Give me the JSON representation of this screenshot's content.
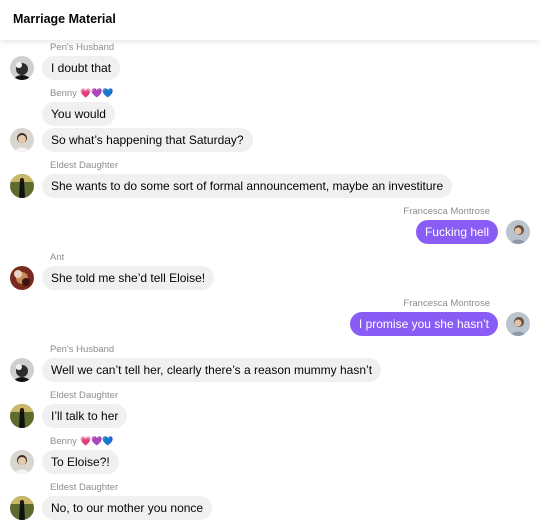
{
  "header": {
    "title": "Marriage Material"
  },
  "senders": {
    "pens_husband": "Pen's Husband",
    "benny": "Benny",
    "eldest_daughter": "Eldest Daughter",
    "francesca": "Francesca Montrose",
    "ant": "Ant"
  },
  "emoji": {
    "hearts": [
      "💗",
      "💜",
      "💙"
    ]
  },
  "messages": [
    {
      "text": "I doubt that"
    },
    {
      "text": "You would"
    },
    {
      "text": "So what’s happening that Saturday?"
    },
    {
      "text": "She wants to do some sort of formal announcement, maybe an investiture"
    },
    {
      "text": "Fucking hell"
    },
    {
      "text": "She told me she’d tell Eloise!"
    },
    {
      "text": "I promise you she hasn’t"
    },
    {
      "text": "Well we can’t tell her, clearly there’s a reason mummy hasn’t"
    },
    {
      "text": "I’ll talk to her"
    },
    {
      "text": "To Eloise?!"
    },
    {
      "text": "No, to our mother you nonce"
    }
  ],
  "colors": {
    "outgoing_bubble": "#8a5cf6",
    "incoming_bubble": "#f0f0f0",
    "sender_label": "#8a8d91"
  }
}
